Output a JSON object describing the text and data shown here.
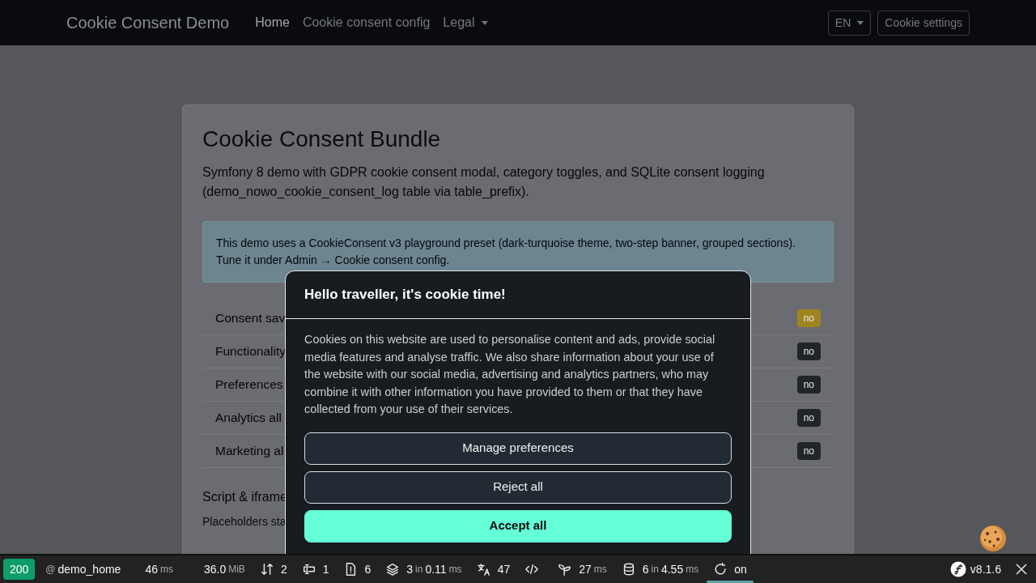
{
  "navbar": {
    "brand": "Cookie Consent Demo",
    "links": [
      {
        "label": "Home",
        "selected": true,
        "dropdown": false
      },
      {
        "label": "Cookie consent config",
        "selected": false,
        "dropdown": false
      },
      {
        "label": "Legal",
        "selected": false,
        "dropdown": true
      }
    ],
    "language": "EN",
    "settings_button": "Cookie settings"
  },
  "card": {
    "title": "Cookie Consent Bundle",
    "lead": "Symfony 8 demo with GDPR cookie consent modal, category toggles, and SQLite consent logging (demo_nowo_cookie_consent_log table via table_prefix).",
    "notice": "This demo uses a CookieConsent v3 playground preset (dark-turquoise theme, two-step banner, grouped sections). Tune it under Admin → Cookie consent config.",
    "rows": [
      {
        "label": "Consent sav",
        "badge": "no",
        "color": "#a08420"
      },
      {
        "label": "Functionality",
        "badge": "no",
        "color": "#212429"
      },
      {
        "label": "Preferences",
        "badge": "no",
        "color": "#212429"
      },
      {
        "label": "Analytics all",
        "badge": "no",
        "color": "#212429"
      },
      {
        "label": "Marketing al",
        "badge": "no",
        "color": "#212429"
      }
    ],
    "section_title": "Script & iframe",
    "section_text": "Placeholders sta"
  },
  "modal": {
    "title": "Hello traveller, it's cookie time!",
    "text": "Cookies on this website are used to personalise content and ads, provide social media features and analyse traffic. We also share information about your use of the website with our social media, advertising and analytics partners, who may combine it with other information you have provided to them or that they have collected from your use of their services.",
    "buttons": [
      {
        "label": "Manage preferences",
        "kind": "secondary"
      },
      {
        "label": "Reject all",
        "kind": "secondary"
      },
      {
        "label": "Accept all",
        "kind": "primary"
      }
    ]
  },
  "debug_toolbar": {
    "status": "200",
    "items": [
      {
        "kind": "route",
        "parts": [
          {
            "text": "@",
            "muted": true
          },
          {
            "text": "demo_home",
            "muted": false
          }
        ]
      },
      {
        "kind": "time",
        "parts": [
          {
            "text": "46",
            "muted": false
          },
          {
            "text": "ms",
            "muted": true
          }
        ]
      },
      {
        "kind": "memory",
        "parts": [
          {
            "text": "36.0",
            "muted": false
          },
          {
            "text": "MiB",
            "muted": true
          }
        ]
      },
      {
        "kind": "requests",
        "parts": [
          {
            "text": "2",
            "muted": false
          }
        ]
      },
      {
        "kind": "forms",
        "parts": [
          {
            "text": "1",
            "muted": false
          }
        ]
      },
      {
        "kind": "logs",
        "parts": [
          {
            "text": "6",
            "muted": false
          }
        ]
      },
      {
        "kind": "cache",
        "parts": [
          {
            "text": "3",
            "muted": false
          },
          {
            "text": "in",
            "muted": true
          },
          {
            "text": "0.11",
            "muted": false
          },
          {
            "text": "ms",
            "muted": true
          }
        ]
      },
      {
        "kind": "translation",
        "parts": [
          {
            "text": "47",
            "muted": false
          }
        ]
      },
      {
        "kind": "code"
      },
      {
        "kind": "twig",
        "parts": [
          {
            "text": "27",
            "muted": false
          },
          {
            "text": "ms",
            "muted": true
          }
        ]
      },
      {
        "kind": "database",
        "parts": [
          {
            "text": "6",
            "muted": false
          },
          {
            "text": "in",
            "muted": true
          },
          {
            "text": "4.55",
            "muted": false
          },
          {
            "text": "ms",
            "muted": true
          }
        ]
      },
      {
        "kind": "reload",
        "selected": true,
        "parts": [
          {
            "text": "on",
            "muted": false
          }
        ]
      }
    ],
    "version": "v8.1.6"
  }
}
